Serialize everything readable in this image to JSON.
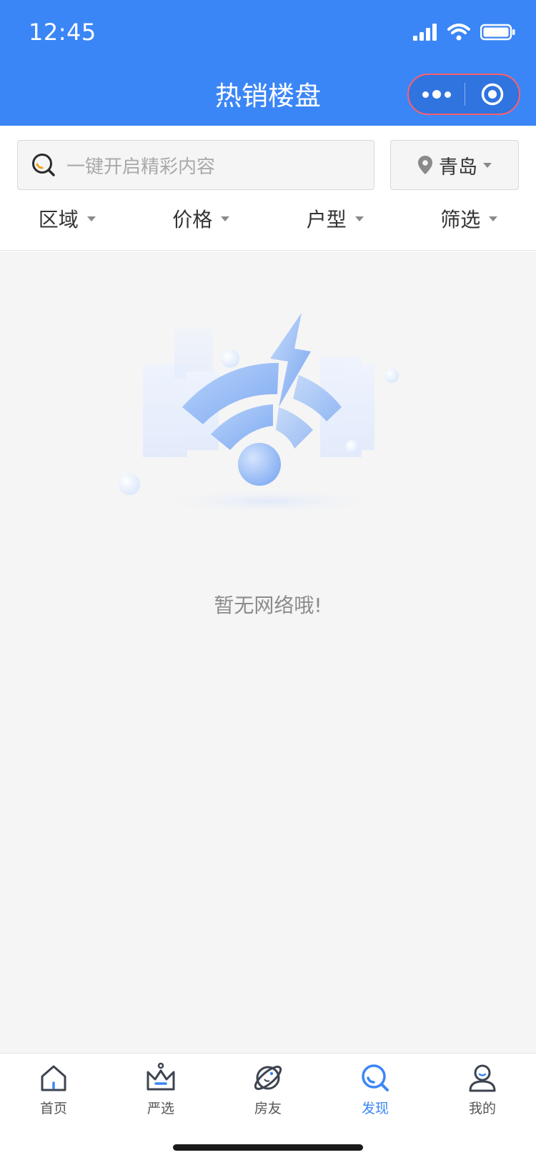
{
  "status_bar": {
    "time": "12:45"
  },
  "nav": {
    "title": "热销楼盘"
  },
  "search": {
    "placeholder": "一键开启精彩内容"
  },
  "city": {
    "label": "青岛"
  },
  "filters": [
    {
      "label": "区域"
    },
    {
      "label": "价格"
    },
    {
      "label": "户型"
    },
    {
      "label": "筛选"
    }
  ],
  "empty": {
    "message": "暂无网络哦!"
  },
  "tabbar": {
    "items": [
      {
        "label": "首页",
        "icon": "home-icon"
      },
      {
        "label": "严选",
        "icon": "crown-icon"
      },
      {
        "label": "房友",
        "icon": "planet-icon"
      },
      {
        "label": "发现",
        "icon": "discover-icon",
        "active": true
      },
      {
        "label": "我的",
        "icon": "user-icon"
      }
    ]
  },
  "colors": {
    "accent": "#3b86f6",
    "background": "#f5f5f5",
    "text": "#333333",
    "muted": "#8c8c8c"
  }
}
